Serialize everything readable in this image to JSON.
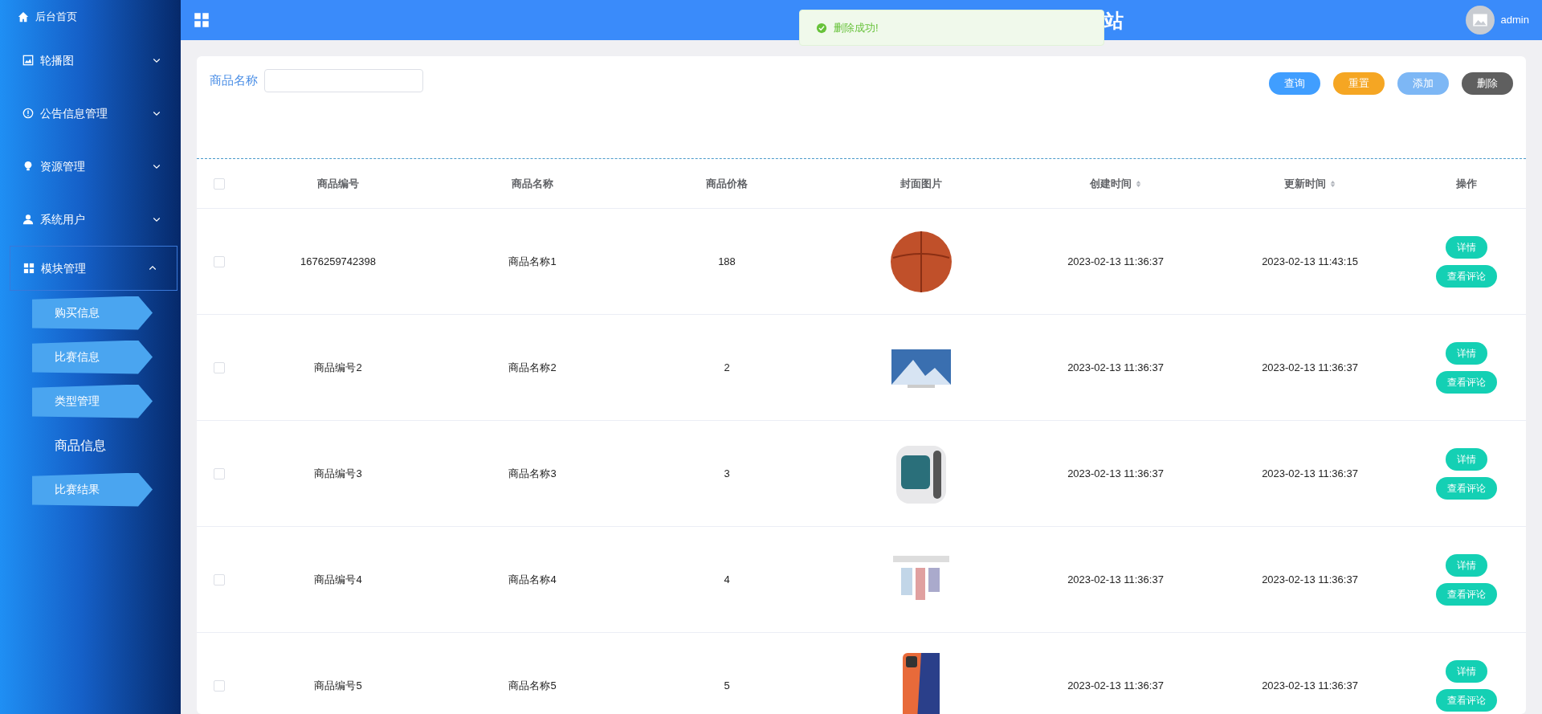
{
  "sidebar": {
    "items": [
      {
        "label": "后台首页"
      },
      {
        "label": "轮播图",
        "expanded": false
      },
      {
        "label": "公告信息管理",
        "expanded": false
      },
      {
        "label": "资源管理",
        "expanded": false
      },
      {
        "label": "系统用户",
        "expanded": false
      },
      {
        "label": "模块管理",
        "expanded": true,
        "children": [
          {
            "label": "购买信息",
            "selected": false
          },
          {
            "label": "比赛信息",
            "selected": false
          },
          {
            "label": "类型管理",
            "selected": false
          },
          {
            "label": "商品信息",
            "selected": true
          },
          {
            "label": "比赛结果",
            "selected": false
          }
        ]
      }
    ]
  },
  "header": {
    "title": "站",
    "user": "admin"
  },
  "toast": {
    "message": "删除成功!"
  },
  "search": {
    "label": "商品名称"
  },
  "buttons": [
    {
      "label": "查询",
      "kind": "query"
    },
    {
      "label": "重置",
      "kind": "reset"
    },
    {
      "label": "添加",
      "kind": "add"
    },
    {
      "label": "删除",
      "kind": "delete"
    }
  ],
  "table": {
    "all_checked": false,
    "columns": [
      {
        "label": "商品编号",
        "sortable": false
      },
      {
        "label": "商品名称",
        "sortable": false
      },
      {
        "label": "商品价格",
        "sortable": false
      },
      {
        "label": "封面图片",
        "sortable": false
      },
      {
        "label": "创建时间",
        "sortable": true
      },
      {
        "label": "更新时间",
        "sortable": true
      },
      {
        "label": "操作",
        "sortable": false
      }
    ],
    "rows": [
      {
        "checked": false,
        "code": "1676259742398",
        "name": "商品名称1",
        "price": "188",
        "created": "2023-02-13 11:36:37",
        "updated": "2023-02-13 11:43:15",
        "actions": [
          "详情",
          "查看评论"
        ]
      },
      {
        "checked": false,
        "code": "商品编号2",
        "name": "商品名称2",
        "price": "2",
        "created": "2023-02-13 11:36:37",
        "updated": "2023-02-13 11:36:37",
        "actions": [
          "详情",
          "查看评论"
        ]
      },
      {
        "checked": false,
        "code": "商品编号3",
        "name": "商品名称3",
        "price": "3",
        "created": "2023-02-13 11:36:37",
        "updated": "2023-02-13 11:36:37",
        "actions": [
          "详情",
          "查看评论"
        ]
      },
      {
        "checked": false,
        "code": "商品编号4",
        "name": "商品名称4",
        "price": "4",
        "created": "2023-02-13 11:36:37",
        "updated": "2023-02-13 11:36:37",
        "actions": [
          "详情",
          "查看评论"
        ]
      },
      {
        "checked": false,
        "code": "商品编号5",
        "name": "商品名称5",
        "price": "5",
        "created": "2023-02-13 11:36:37",
        "updated": "2023-02-13 11:36:37",
        "actions": [
          "详情",
          "查看评论"
        ]
      }
    ]
  }
}
